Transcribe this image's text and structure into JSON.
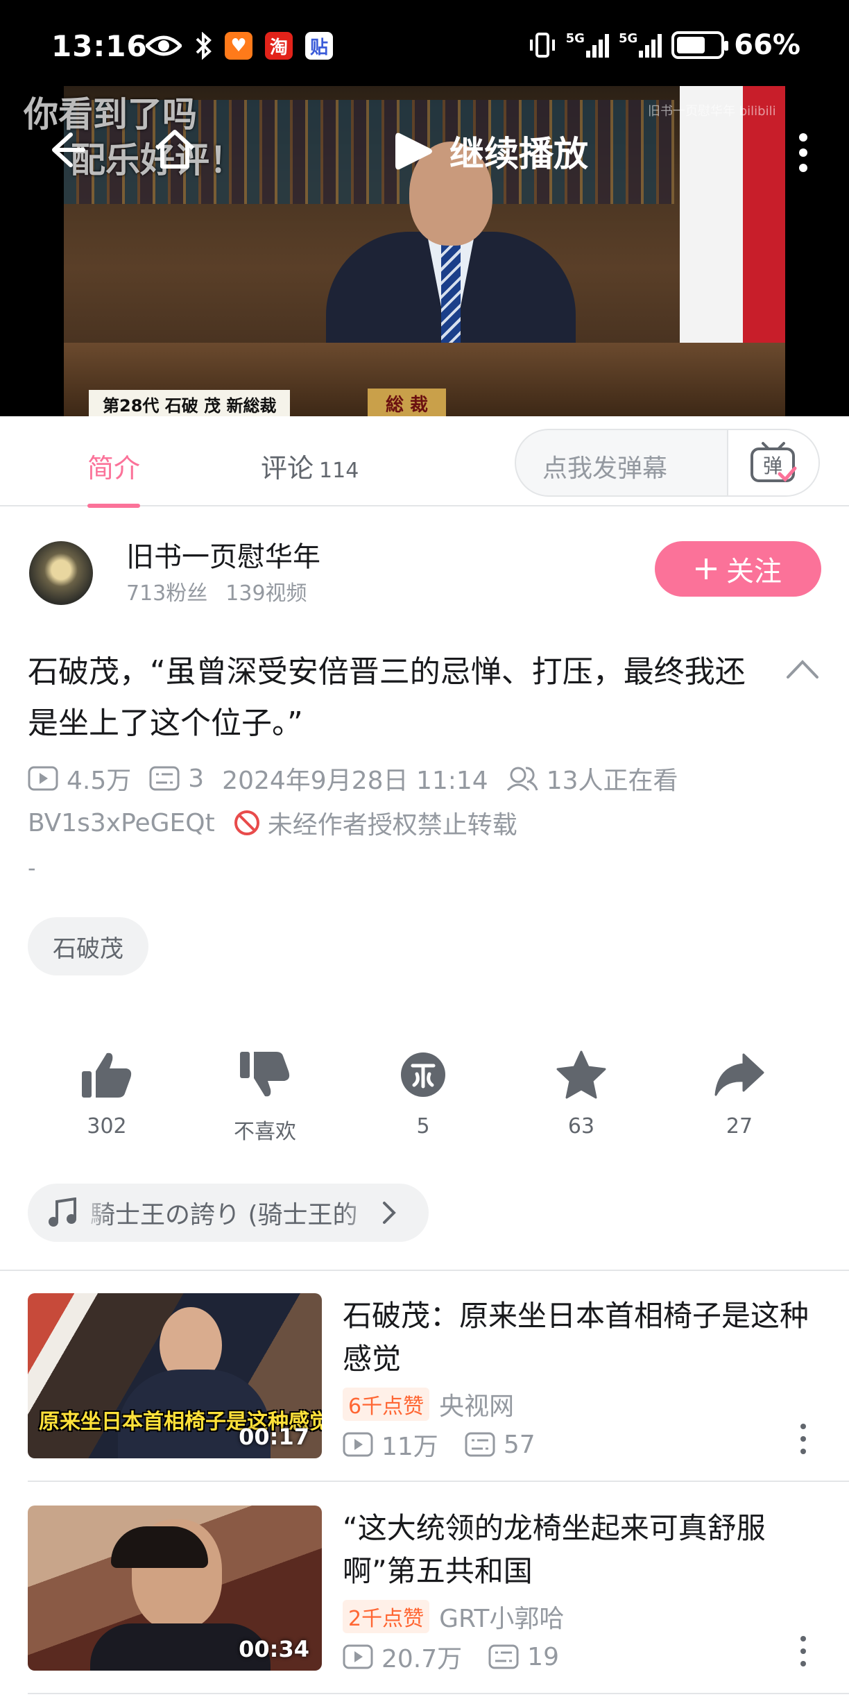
{
  "status_bar": {
    "time": "13:16",
    "battery": "66%",
    "network": [
      "5G",
      "5G"
    ],
    "icons": [
      "eye-icon",
      "bluetooth-icon",
      "taobao-coupon-icon",
      "taobao-icon",
      "tieba-icon",
      "vibrate-icon"
    ]
  },
  "video": {
    "danmaku_lines": [
      "你看到了吗",
      "配乐好评！"
    ],
    "continue_label": "继续播放",
    "watermark": "旧书一页慰华年 bilibili",
    "caption_left": "第28代 石破 茂 新総裁",
    "caption_right": "総 裁"
  },
  "tabs": {
    "intro": "简介",
    "comments": "评论",
    "comments_count": "114",
    "danmaku_placeholder": "点我发弹幕",
    "danmaku_button": "弹"
  },
  "uploader": {
    "name": "旧书一页慰华年",
    "fans": "713粉丝",
    "videos": "139视频",
    "follow_label": "关注"
  },
  "video_info": {
    "title": "石破茂，“虽曾深受安倍晋三的忌惮、打压，最终我还是坐上了这个位子。”",
    "views": "4.5万",
    "danmaku_count": "3",
    "date": "2024年9月28日 11:14",
    "watching": "13人正在看",
    "bvid": "BV1s3xPeGEQt",
    "no_repost": "未经作者授权禁止转载",
    "description": "-",
    "tag": "石破茂"
  },
  "actions": {
    "like": "302",
    "dislike": "不喜欢",
    "coin": "5",
    "favorite": "63",
    "share": "27"
  },
  "music": {
    "label": "騎士王の誇り (骑士王的"
  },
  "related": [
    {
      "title": "石破茂：原来坐日本首相椅子是这种感觉",
      "badge": "6千点赞",
      "author": "央视网",
      "views": "11万",
      "danmaku": "57",
      "duration": "00:17",
      "thumb_text": "原来坐日本首相椅子是这种感觉"
    },
    {
      "title": "“这大统领的龙椅坐起来可真舒服啊”第五共和国",
      "badge": "2千点赞",
      "author": "GRT小郭哈",
      "views": "20.7万",
      "danmaku": "19",
      "duration": "00:34",
      "thumb_text": ""
    }
  ],
  "colors": {
    "accent": "#fb7299",
    "text_primary": "#18191c",
    "text_secondary": "#9499a0",
    "badge_orange": "#ff6633"
  }
}
